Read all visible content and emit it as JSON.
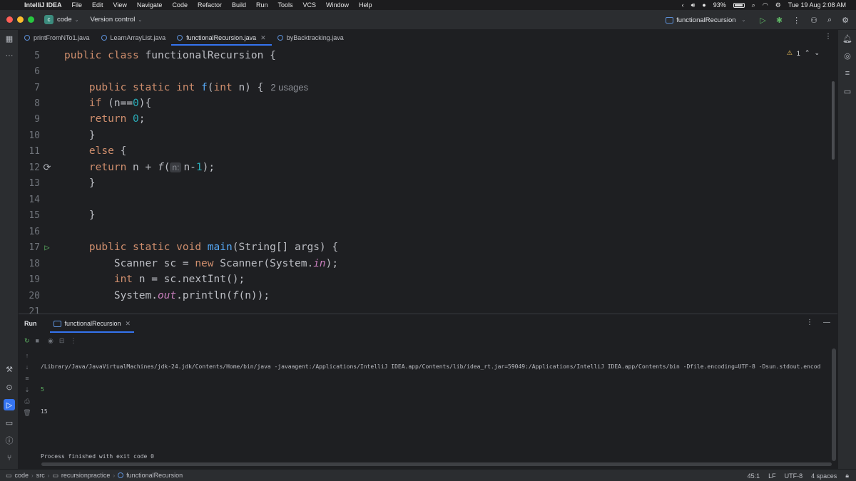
{
  "menubar": {
    "app_name": "IntelliJ IDEA",
    "items": [
      "File",
      "Edit",
      "View",
      "Navigate",
      "Code",
      "Refactor",
      "Build",
      "Run",
      "Tools",
      "VCS",
      "Window",
      "Help"
    ],
    "battery": "93%",
    "datetime": "Tue 19 Aug  2:08 AM"
  },
  "toolbar": {
    "project_badge": "c",
    "project_name": "code",
    "vcs_label": "Version control",
    "run_config": "functionalRecursion"
  },
  "tabs": [
    {
      "label": "printFromNTo1.java",
      "active": false
    },
    {
      "label": "LearnArrayList.java",
      "active": false
    },
    {
      "label": "functionalRecursion.java",
      "active": true
    },
    {
      "label": "byBacktracking.java",
      "active": false
    }
  ],
  "editor": {
    "warning_count": "1",
    "lines": [
      {
        "n": "5"
      },
      {
        "n": "6"
      },
      {
        "n": "7"
      },
      {
        "n": "8"
      },
      {
        "n": "9"
      },
      {
        "n": "10"
      },
      {
        "n": "11"
      },
      {
        "n": "12"
      },
      {
        "n": "13"
      },
      {
        "n": "14"
      },
      {
        "n": "15"
      },
      {
        "n": "16"
      },
      {
        "n": "17"
      },
      {
        "n": "18"
      },
      {
        "n": "19"
      },
      {
        "n": "20"
      },
      {
        "n": "21"
      }
    ],
    "class_name": "functionalRecursion",
    "usages_hint": "2 usages",
    "param_hint": "n:"
  },
  "run_panel": {
    "title": "Run",
    "tab_label": "functionalRecursion",
    "console": [
      "/Library/Java/JavaVirtualMachines/jdk-24.jdk/Contents/Home/bin/java -javaagent:/Applications/IntelliJ IDEA.app/Contents/lib/idea_rt.jar=59049:/Applications/IntelliJ IDEA.app/Contents/bin -Dfile.encoding=UTF-8 -Dsun.stdout.encod",
      "5",
      "15",
      "",
      "Process finished with exit code 0"
    ]
  },
  "statusbar": {
    "breadcrumbs": [
      "code",
      "src",
      "recursionpractice",
      "functionalRecursion"
    ],
    "position": "45:1",
    "line_ending": "LF",
    "encoding": "UTF-8",
    "indent": "4 spaces"
  }
}
